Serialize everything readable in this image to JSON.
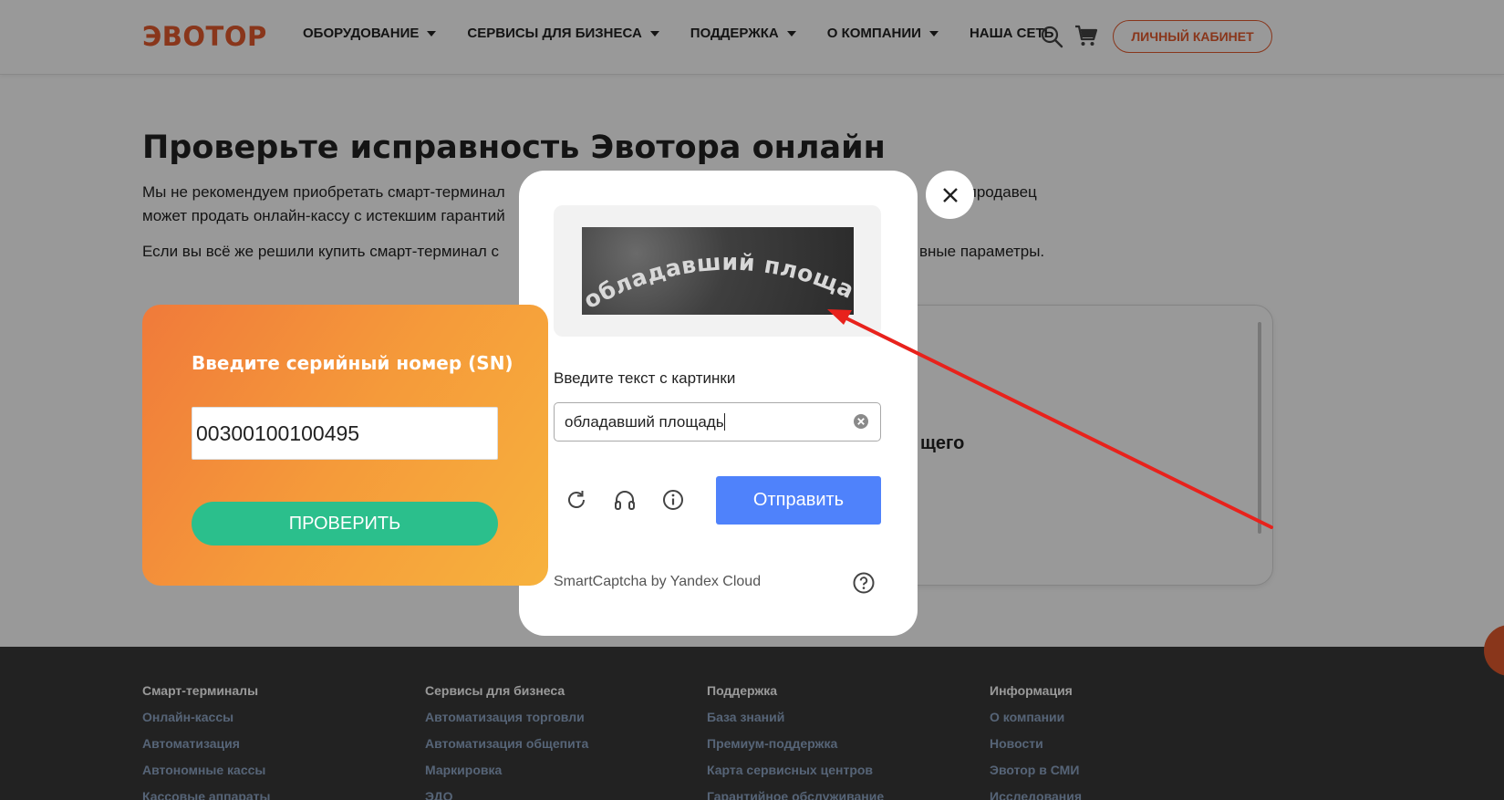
{
  "header": {
    "logo": "ЭВОТОР",
    "nav": [
      {
        "label": "ОБОРУДОВАНИЕ",
        "dropdown": true
      },
      {
        "label": "СЕРВИСЫ ДЛЯ БИЗНЕСА",
        "dropdown": true
      },
      {
        "label": "ПОДДЕРЖКА",
        "dropdown": true
      },
      {
        "label": "О КОМПАНИИ",
        "dropdown": true
      },
      {
        "label": "НАША СЕТЬ",
        "dropdown": false
      }
    ],
    "cabinet_label": "ЛИЧНЫЙ КАБИНЕТ"
  },
  "main": {
    "title": "Проверьте исправность Эвотора онлайн",
    "para1_line1": "Мы не рекомендуем приобретать смарт-терминал",
    "para1_line1_end": "тный продавец",
    "para1_line2": "может продать онлайн-кассу с истекшим гарантий",
    "para2": "Если вы всё же решили купить смарт-терминал с",
    "para2_end": "вные параметры.",
    "sn_label": "Введите серийный номер (SN)",
    "sn_value": "00300100100495",
    "check_label": "ПРОВЕРИТЬ",
    "info_text": "щего"
  },
  "footer": {
    "columns": [
      {
        "heading": "Смарт-терминалы",
        "links": [
          "Онлайн-кассы",
          "Автоматизация",
          "Автономные кассы",
          "Кассовые аппараты"
        ]
      },
      {
        "heading": "Сервисы для бизнеса",
        "links": [
          "Автоматизация торговли",
          "Автоматизация общепита",
          "Маркировка",
          "ЭДО"
        ]
      },
      {
        "heading": "Поддержка",
        "links": [
          "База знаний",
          "Премиум-поддержка",
          "Карта сервисных центров",
          "Гарантийное обслуживание"
        ]
      },
      {
        "heading": "Информация",
        "links": [
          "О компании",
          "Новости",
          "Эвотор в СМИ",
          "Исследования"
        ]
      }
    ]
  },
  "captcha": {
    "image_text": "обладавший площадь",
    "label": "Введите текст с картинки",
    "input_value": "обладавший площадь",
    "submit_label": "Отправить",
    "brand": "SmartCaptcha by Yandex Cloud"
  },
  "icons": {
    "search": "search-icon",
    "cart": "cart-icon",
    "close": "close-icon",
    "refresh": "refresh-icon",
    "audio": "headphones-icon",
    "info": "info-icon",
    "help": "help-icon",
    "clear": "clear-icon"
  },
  "colors": {
    "brand": "#e45a2e",
    "check_button": "#2bbf8c",
    "submit_button": "#4f82fb",
    "annotation_arrow": "#e8221c"
  }
}
